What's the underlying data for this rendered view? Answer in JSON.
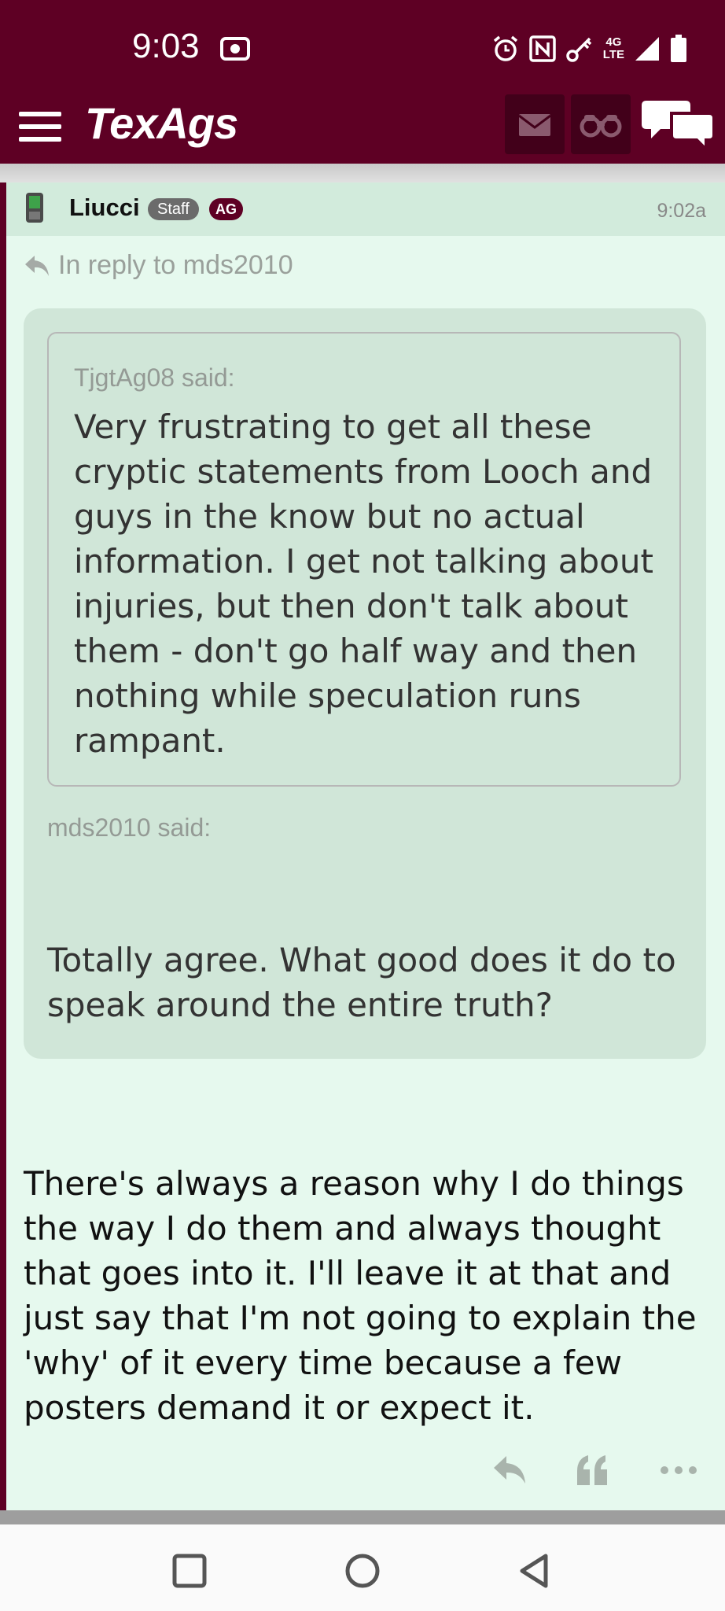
{
  "status_bar": {
    "time": "9:03",
    "network_label_top": "4G",
    "network_label_bottom": "LTE",
    "icons": [
      "camera-icon",
      "alarm-icon",
      "nfc-icon",
      "vpn-key-icon",
      "signal-icon",
      "battery-icon"
    ]
  },
  "topnav": {
    "logo": "TexAgs",
    "icons": [
      "menu-icon",
      "mail-icon",
      "binoculars-icon",
      "chat-bubbles-icon"
    ]
  },
  "post": {
    "username": "Liucci",
    "staff_badge": "Staff",
    "ag_badge": "AG",
    "time": "9:02a",
    "reply_to": "In reply to mds2010",
    "nested_quote": {
      "author_said": "TjgtAg08 said:",
      "text": "Very frustrating to get all these cryptic statements from Looch and guys in the know but no actual information. I get not talking about injuries, but then don't talk about them - don't go half way and then nothing while speculation runs rampant."
    },
    "quote": {
      "author_said": "mds2010 said:",
      "text": "Totally agree. What good does it do to speak around the entire truth?"
    },
    "body": "There's always a reason why I do things the way I do them and always thought that goes into it. I'll leave it at that and just say that I'm not going to explain the 'why' of it every time because a few posters demand it or expect it.",
    "actions": [
      "reply-icon",
      "quote-icon",
      "more-icon"
    ]
  },
  "colors": {
    "brand_maroon": "#5e0024",
    "post_background": "#e6f9ee",
    "header_background": "#d2ebdc",
    "quote_background": "#d0e6d8"
  }
}
